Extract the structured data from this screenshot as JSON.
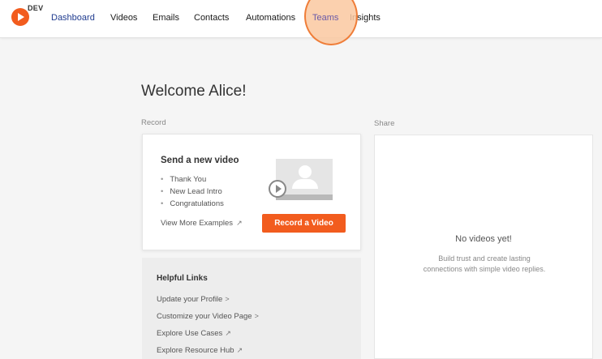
{
  "app": {
    "env_badge": "DEV"
  },
  "nav": {
    "items": [
      {
        "label": "Dashboard"
      },
      {
        "label": "Videos"
      },
      {
        "label": "Emails"
      },
      {
        "label": "Contacts"
      },
      {
        "label": "Automations"
      },
      {
        "label": "Teams"
      },
      {
        "label": "Insights"
      }
    ],
    "active": "Dashboard",
    "hovered": "Teams"
  },
  "main": {
    "welcome": "Welcome Alice!",
    "record_label": "Record",
    "share_label": "Share",
    "record_card": {
      "title": "Send a new video",
      "examples": [
        "Thank You",
        "New Lead Intro",
        "Congratulations"
      ],
      "view_more": "View More Examples",
      "view_more_icon": "external-link-icon",
      "record_button": "Record a Video"
    },
    "helpful_links": {
      "title": "Helpful Links",
      "links": [
        {
          "label": "Update your Profile",
          "suffix": ">"
        },
        {
          "label": "Customize your Video Page",
          "suffix": ">"
        },
        {
          "label": "Explore Use Cases",
          "suffix": "↗"
        },
        {
          "label": "Explore Resource Hub",
          "suffix": "↗"
        }
      ]
    },
    "share_panel": {
      "empty_title": "No videos yet!",
      "empty_desc_line1": "Build trust and create lasting",
      "empty_desc_line2": "connections with simple video replies."
    }
  },
  "colors": {
    "brand": "#f25c1e",
    "nav_active": "#1f3b8f",
    "highlight": "#ef7d38"
  }
}
